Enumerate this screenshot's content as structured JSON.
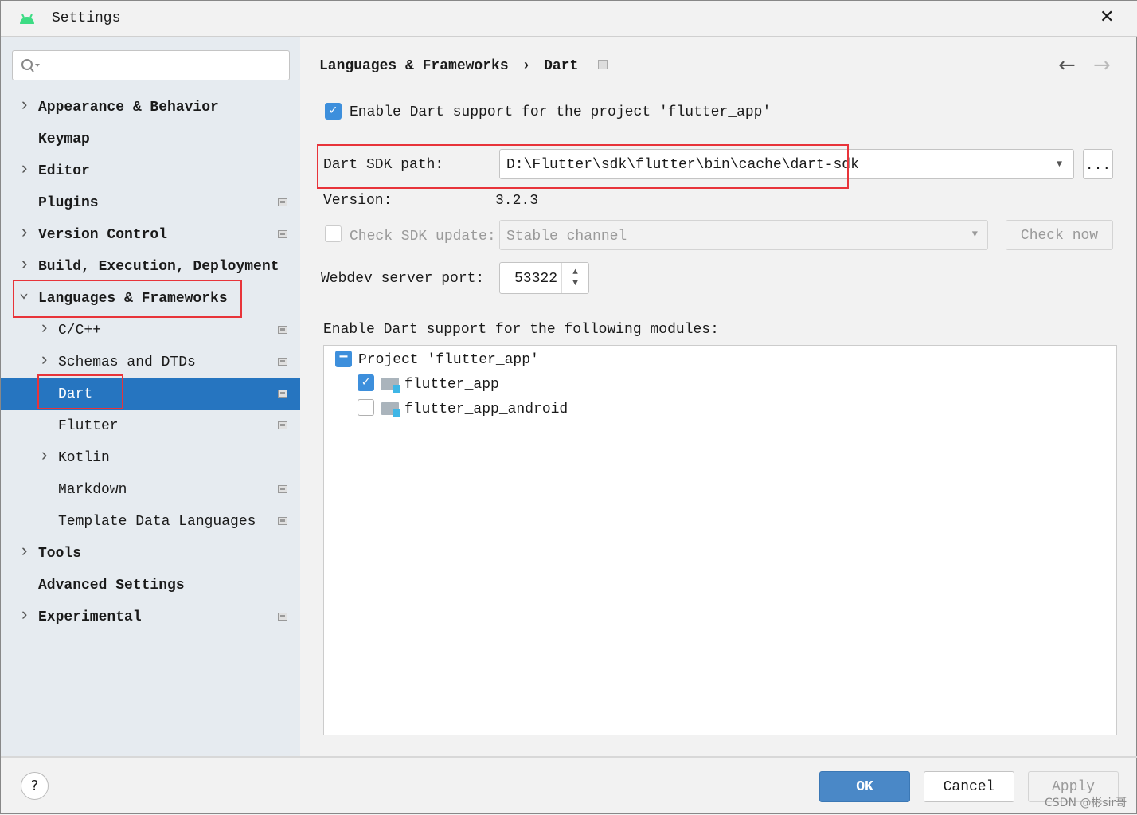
{
  "window": {
    "title": "Settings",
    "app_icon": "android-icon",
    "close_icon": "close-icon"
  },
  "search": {
    "placeholder": "",
    "value": ""
  },
  "sidebar": {
    "items": [
      {
        "label": "Appearance & Behavior",
        "expandable": true,
        "expanded": false,
        "level": 0
      },
      {
        "label": "Keymap",
        "expandable": false,
        "level": 0
      },
      {
        "label": "Editor",
        "expandable": true,
        "expanded": false,
        "level": 0
      },
      {
        "label": "Plugins",
        "expandable": false,
        "level": 0,
        "project_icon": true
      },
      {
        "label": "Version Control",
        "expandable": true,
        "expanded": false,
        "level": 0,
        "project_icon": true
      },
      {
        "label": "Build, Execution, Deployment",
        "expandable": true,
        "expanded": false,
        "level": 0
      },
      {
        "label": "Languages & Frameworks",
        "expandable": true,
        "expanded": true,
        "level": 0
      },
      {
        "label": "C/C++",
        "expandable": true,
        "level": 1,
        "project_icon": true
      },
      {
        "label": "Schemas and DTDs",
        "expandable": true,
        "level": 1,
        "project_icon": true
      },
      {
        "label": "Dart",
        "expandable": false,
        "level": 1,
        "selected": true,
        "project_icon": true
      },
      {
        "label": "Flutter",
        "expandable": false,
        "level": 1,
        "project_icon": true
      },
      {
        "label": "Kotlin",
        "expandable": true,
        "level": 1
      },
      {
        "label": "Markdown",
        "expandable": false,
        "level": 1,
        "project_icon": true
      },
      {
        "label": "Template Data Languages",
        "expandable": false,
        "level": 1,
        "project_icon": true
      },
      {
        "label": "Tools",
        "expandable": true,
        "level": 0
      },
      {
        "label": "Advanced Settings",
        "expandable": false,
        "level": 0
      },
      {
        "label": "Experimental",
        "expandable": true,
        "level": 0,
        "project_icon": true
      }
    ]
  },
  "breadcrumb": {
    "parent": "Languages & Frameworks",
    "separator": "›",
    "current": "Dart"
  },
  "main": {
    "enable_dart_label": "Enable Dart support for the project 'flutter_app'",
    "enable_dart_checked": true,
    "sdk_path_label": "Dart SDK path:",
    "sdk_path_value": "D:\\Flutter\\sdk\\flutter\\bin\\cache\\dart-sdk",
    "browse_label": "...",
    "version_label": "Version:",
    "version_value": "3.2.3",
    "check_update_label": "Check SDK update:",
    "check_update_checked": false,
    "channel_value": "Stable channel",
    "check_now_label": "Check now",
    "port_label": "Webdev server port:",
    "port_value": "53322",
    "modules_label": "Enable Dart support for the following modules:",
    "modules": {
      "project": "Project 'flutter_app'",
      "items": [
        {
          "label": "flutter_app",
          "checked": true
        },
        {
          "label": "flutter_app_android",
          "checked": false
        }
      ]
    }
  },
  "footer": {
    "help": "?",
    "ok": "OK",
    "cancel": "Cancel",
    "apply": "Apply",
    "watermark": "CSDN @彬sir哥"
  },
  "colors": {
    "selection": "#2675c0",
    "highlight": "#e8343a",
    "ok": "#4a88c7"
  }
}
